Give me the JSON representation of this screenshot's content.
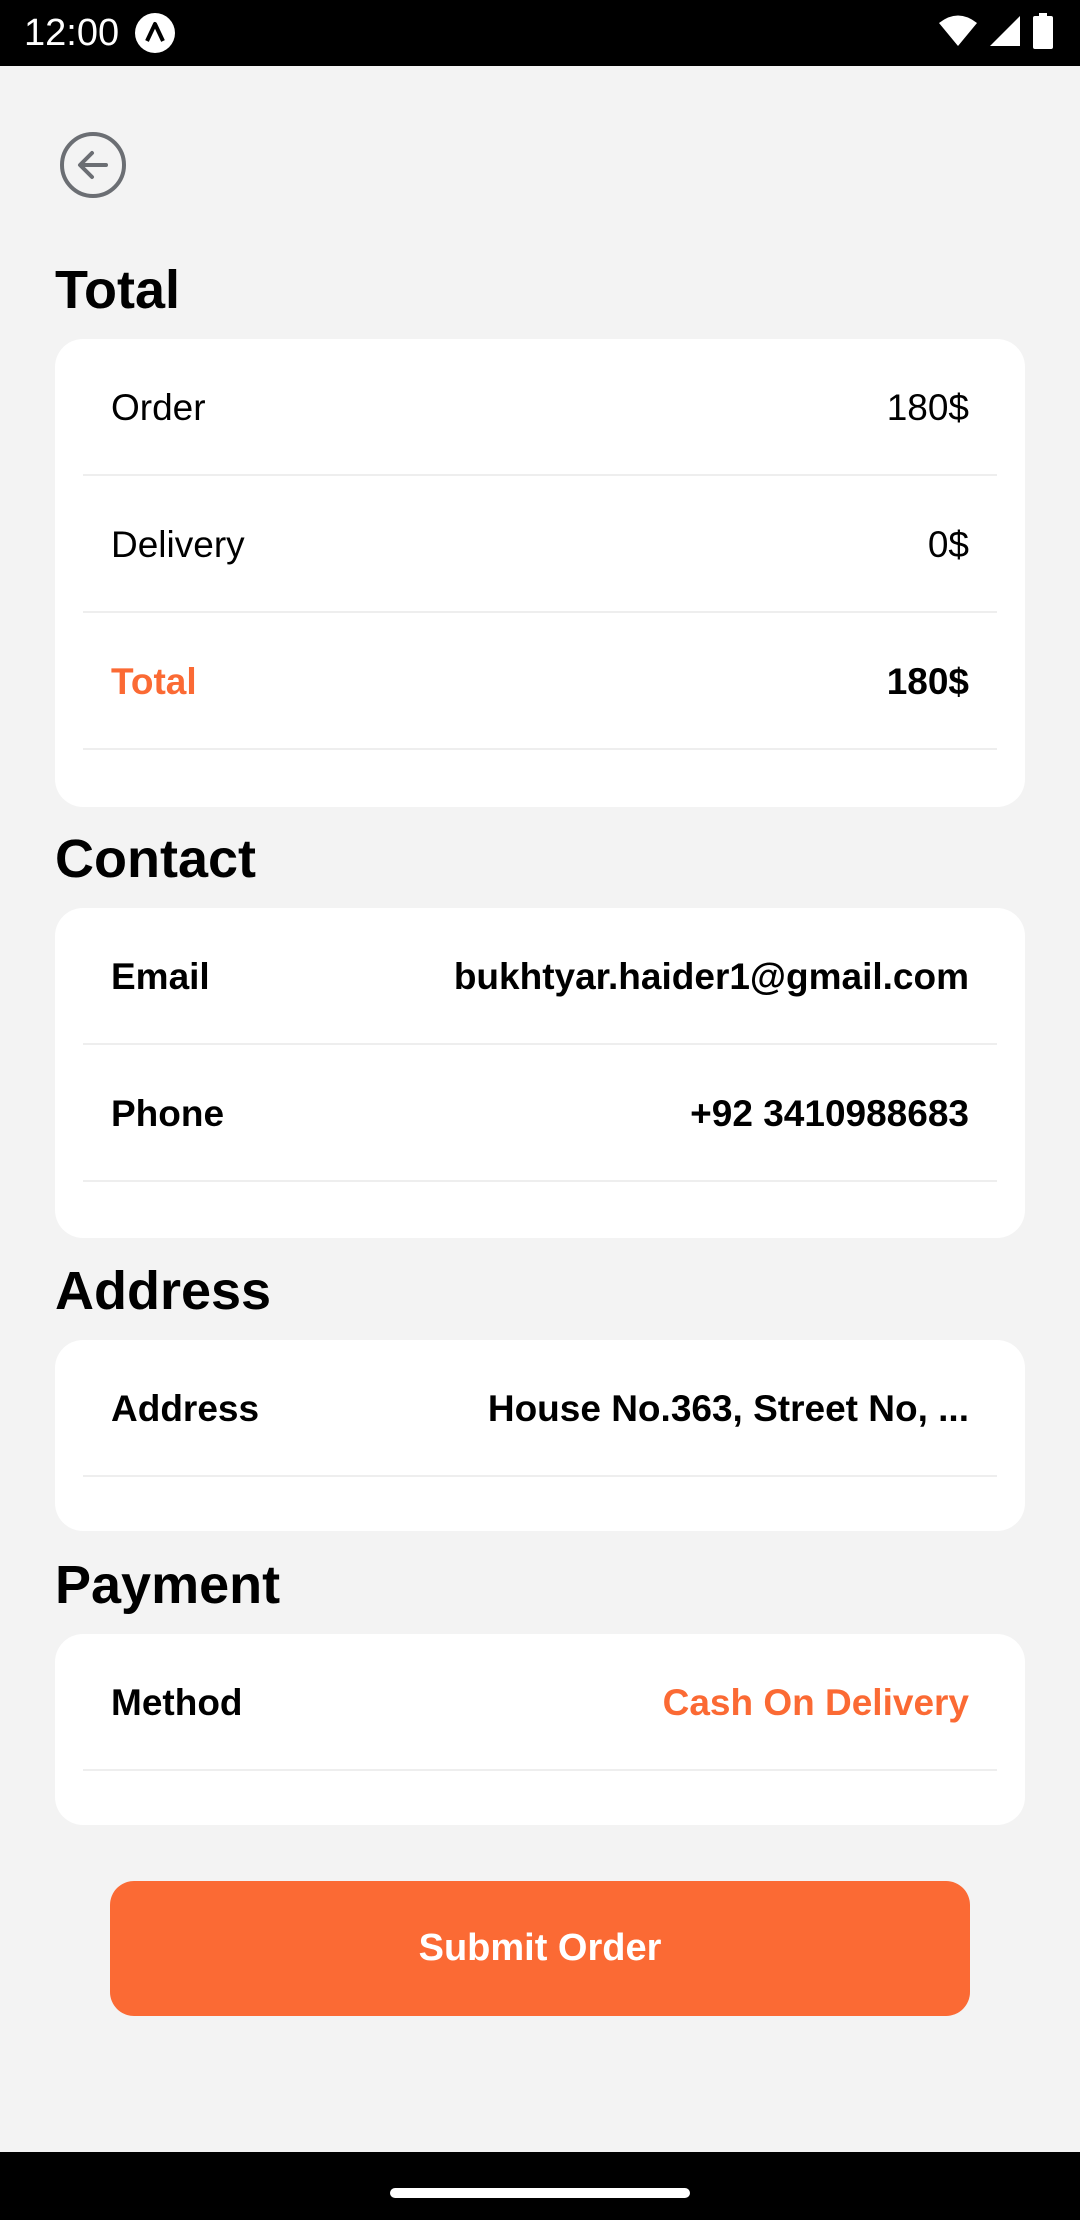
{
  "status_bar": {
    "time": "12:00",
    "icons": [
      "app-notification-icon",
      "wifi-icon",
      "signal-icon",
      "battery-icon"
    ]
  },
  "header": {
    "back_icon": "arrow-left-circle-icon"
  },
  "total_section": {
    "title": "Total",
    "rows": [
      {
        "label": "Order",
        "value": "180$"
      },
      {
        "label": "Delivery",
        "value": "0$"
      },
      {
        "label": "Total",
        "value": "180$"
      }
    ]
  },
  "contact_section": {
    "title": "Contact",
    "rows": [
      {
        "label": "Email",
        "value": "bukhtyar.haider1@gmail.com"
      },
      {
        "label": "Phone",
        "value": "+92 3410988683"
      }
    ]
  },
  "address_section": {
    "title": "Address",
    "rows": [
      {
        "label": "Address",
        "value": "House No.363, Street No, ..."
      }
    ]
  },
  "payment_section": {
    "title": "Payment",
    "rows": [
      {
        "label": "Method",
        "value": "Cash On Delivery"
      }
    ]
  },
  "submit_button": {
    "label": "Submit Order"
  },
  "colors": {
    "accent": "#fb6a34",
    "background": "#f3f3f3",
    "card": "#ffffff"
  }
}
